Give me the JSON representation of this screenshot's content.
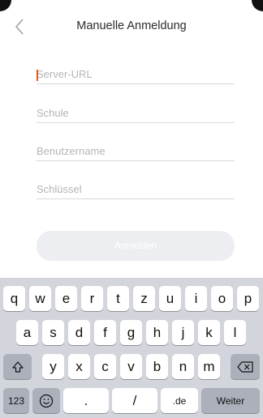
{
  "header": {
    "title": "Manuelle Anmeldung",
    "back_icon": "chevron-left-icon"
  },
  "form": {
    "server_url_placeholder": "Server-URL",
    "school_placeholder": "Schule",
    "username_placeholder": "Benutzername",
    "key_placeholder": "Schlüssel",
    "submit_label": "Anmelden"
  },
  "keyboard": {
    "row1": [
      "q",
      "w",
      "e",
      "r",
      "t",
      "z",
      "u",
      "i",
      "o",
      "p"
    ],
    "row2": [
      "a",
      "s",
      "d",
      "f",
      "g",
      "h",
      "j",
      "k",
      "l"
    ],
    "row3": [
      "y",
      "x",
      "c",
      "v",
      "b",
      "n",
      "m"
    ],
    "shift_icon": "shift-icon",
    "backspace_icon": "backspace-icon",
    "numbers_label": "123",
    "emoji_icon": "emoji-icon",
    "dot_label": ".",
    "slash_label": "/",
    "de_label": ".de",
    "return_label": "Weiter"
  },
  "colors": {
    "caret": "#e05a1f",
    "keyboard_bg": "#d2d5db",
    "button_bg": "#eceef2"
  }
}
